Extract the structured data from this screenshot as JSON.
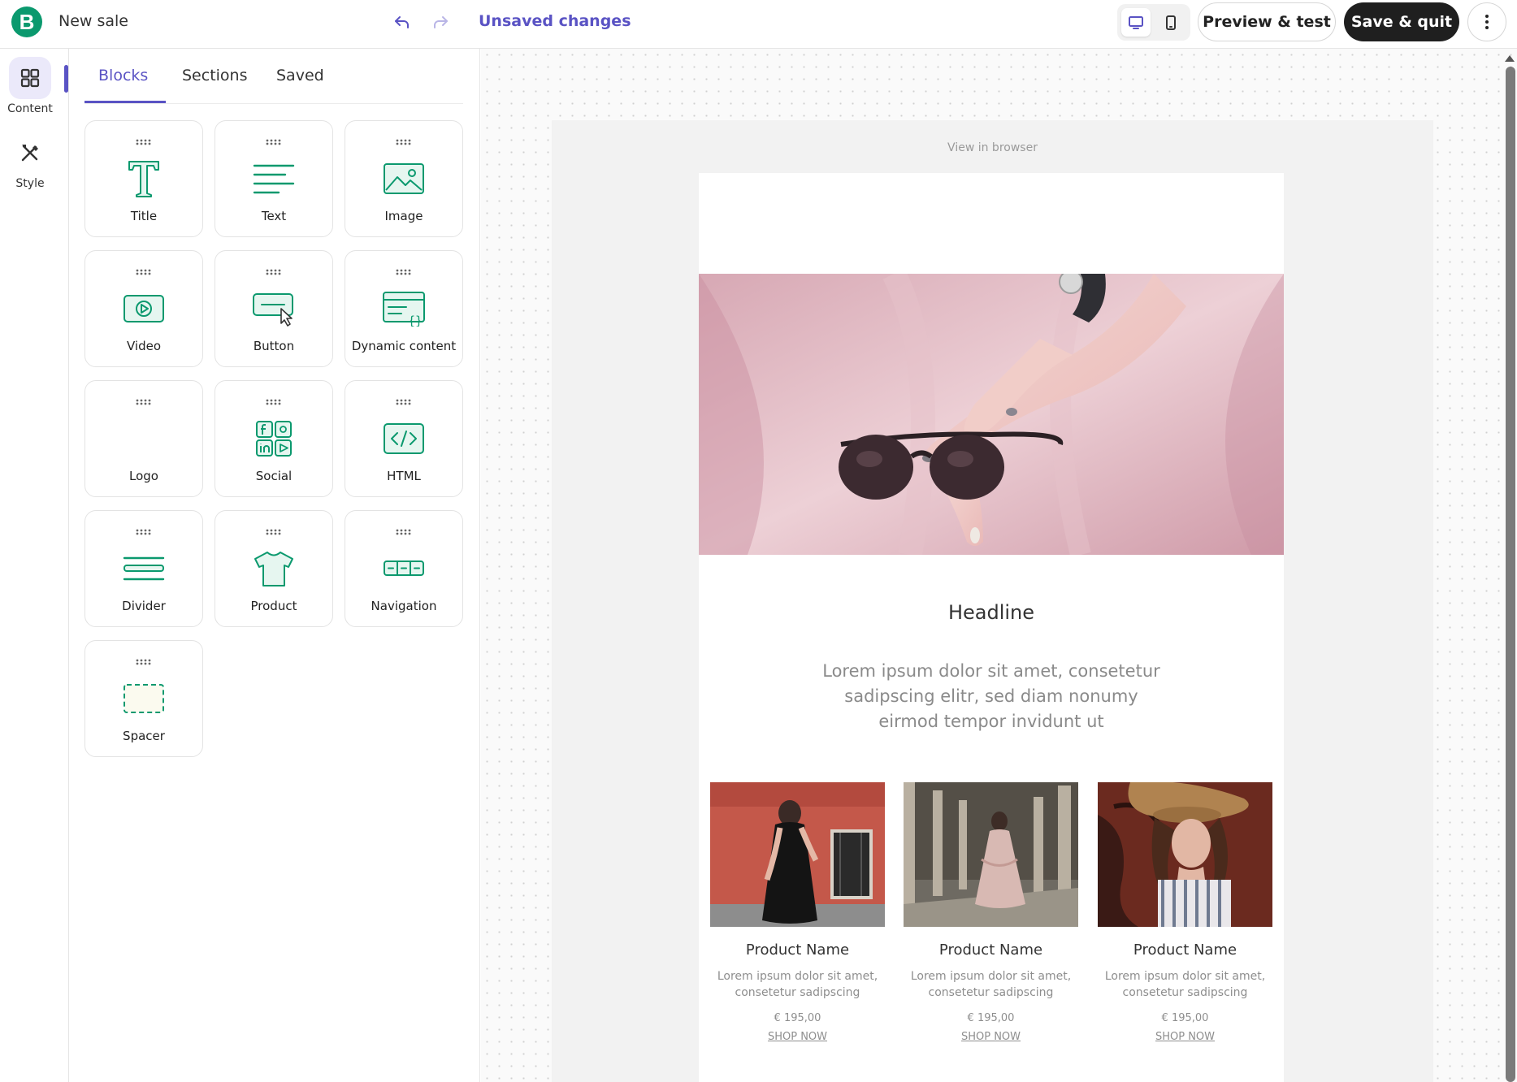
{
  "app": {
    "brand_letter": "B",
    "doc_title": "New sale",
    "status": "Unsaved changes",
    "accent_color": "#5a53c4",
    "brand_color": "#0b996e"
  },
  "toolbar": {
    "undo_icon": "undo-icon",
    "redo_icon": "redo-icon",
    "preview_label": "Preview & test",
    "save_label": "Save & quit",
    "more_icon": "more-vertical-icon"
  },
  "rail": {
    "items": [
      {
        "label": "Content",
        "icon": "grid-icon",
        "active": true
      },
      {
        "label": "Style",
        "icon": "brush-icon",
        "active": false
      }
    ]
  },
  "panel": {
    "tabs": [
      {
        "label": "Blocks",
        "active": true
      },
      {
        "label": "Sections",
        "active": false
      },
      {
        "label": "Saved",
        "active": false
      }
    ],
    "blocks": [
      {
        "label": "Title",
        "icon": "title-icon"
      },
      {
        "label": "Text",
        "icon": "text-icon"
      },
      {
        "label": "Image",
        "icon": "image-icon"
      },
      {
        "label": "Video",
        "icon": "video-icon"
      },
      {
        "label": "Button",
        "icon": "button-icon"
      },
      {
        "label": "Dynamic content",
        "icon": "dynamic-content-icon"
      },
      {
        "label": "Logo",
        "icon": "logo-icon"
      },
      {
        "label": "Social",
        "icon": "social-icon"
      },
      {
        "label": "HTML",
        "icon": "html-icon"
      },
      {
        "label": "Divider",
        "icon": "divider-icon"
      },
      {
        "label": "Product",
        "icon": "tshirt-icon"
      },
      {
        "label": "Navigation",
        "icon": "navigation-icon"
      },
      {
        "label": "Spacer",
        "icon": "spacer-icon"
      }
    ]
  },
  "email": {
    "view_in_browser": "View in browser",
    "headline": "Headline",
    "intro": "Lorem ipsum dolor sit amet, consetetur sadipscing elitr, sed diam nonumy eirmod tempor invidunt ut",
    "products": [
      {
        "name": "Product Name",
        "description": "Lorem ipsum dolor sit amet, consetetur sadipscing",
        "price": "€ 195,00",
        "cta": "SHOP NOW"
      },
      {
        "name": "Product Name",
        "description": "Lorem ipsum dolor sit amet, consetetur sadipscing",
        "price": "€ 195,00",
        "cta": "SHOP NOW"
      },
      {
        "name": "Product Name",
        "description": "Lorem ipsum dolor sit amet, consetetur sadipscing",
        "price": "€ 195,00",
        "cta": "SHOP NOW"
      }
    ]
  }
}
